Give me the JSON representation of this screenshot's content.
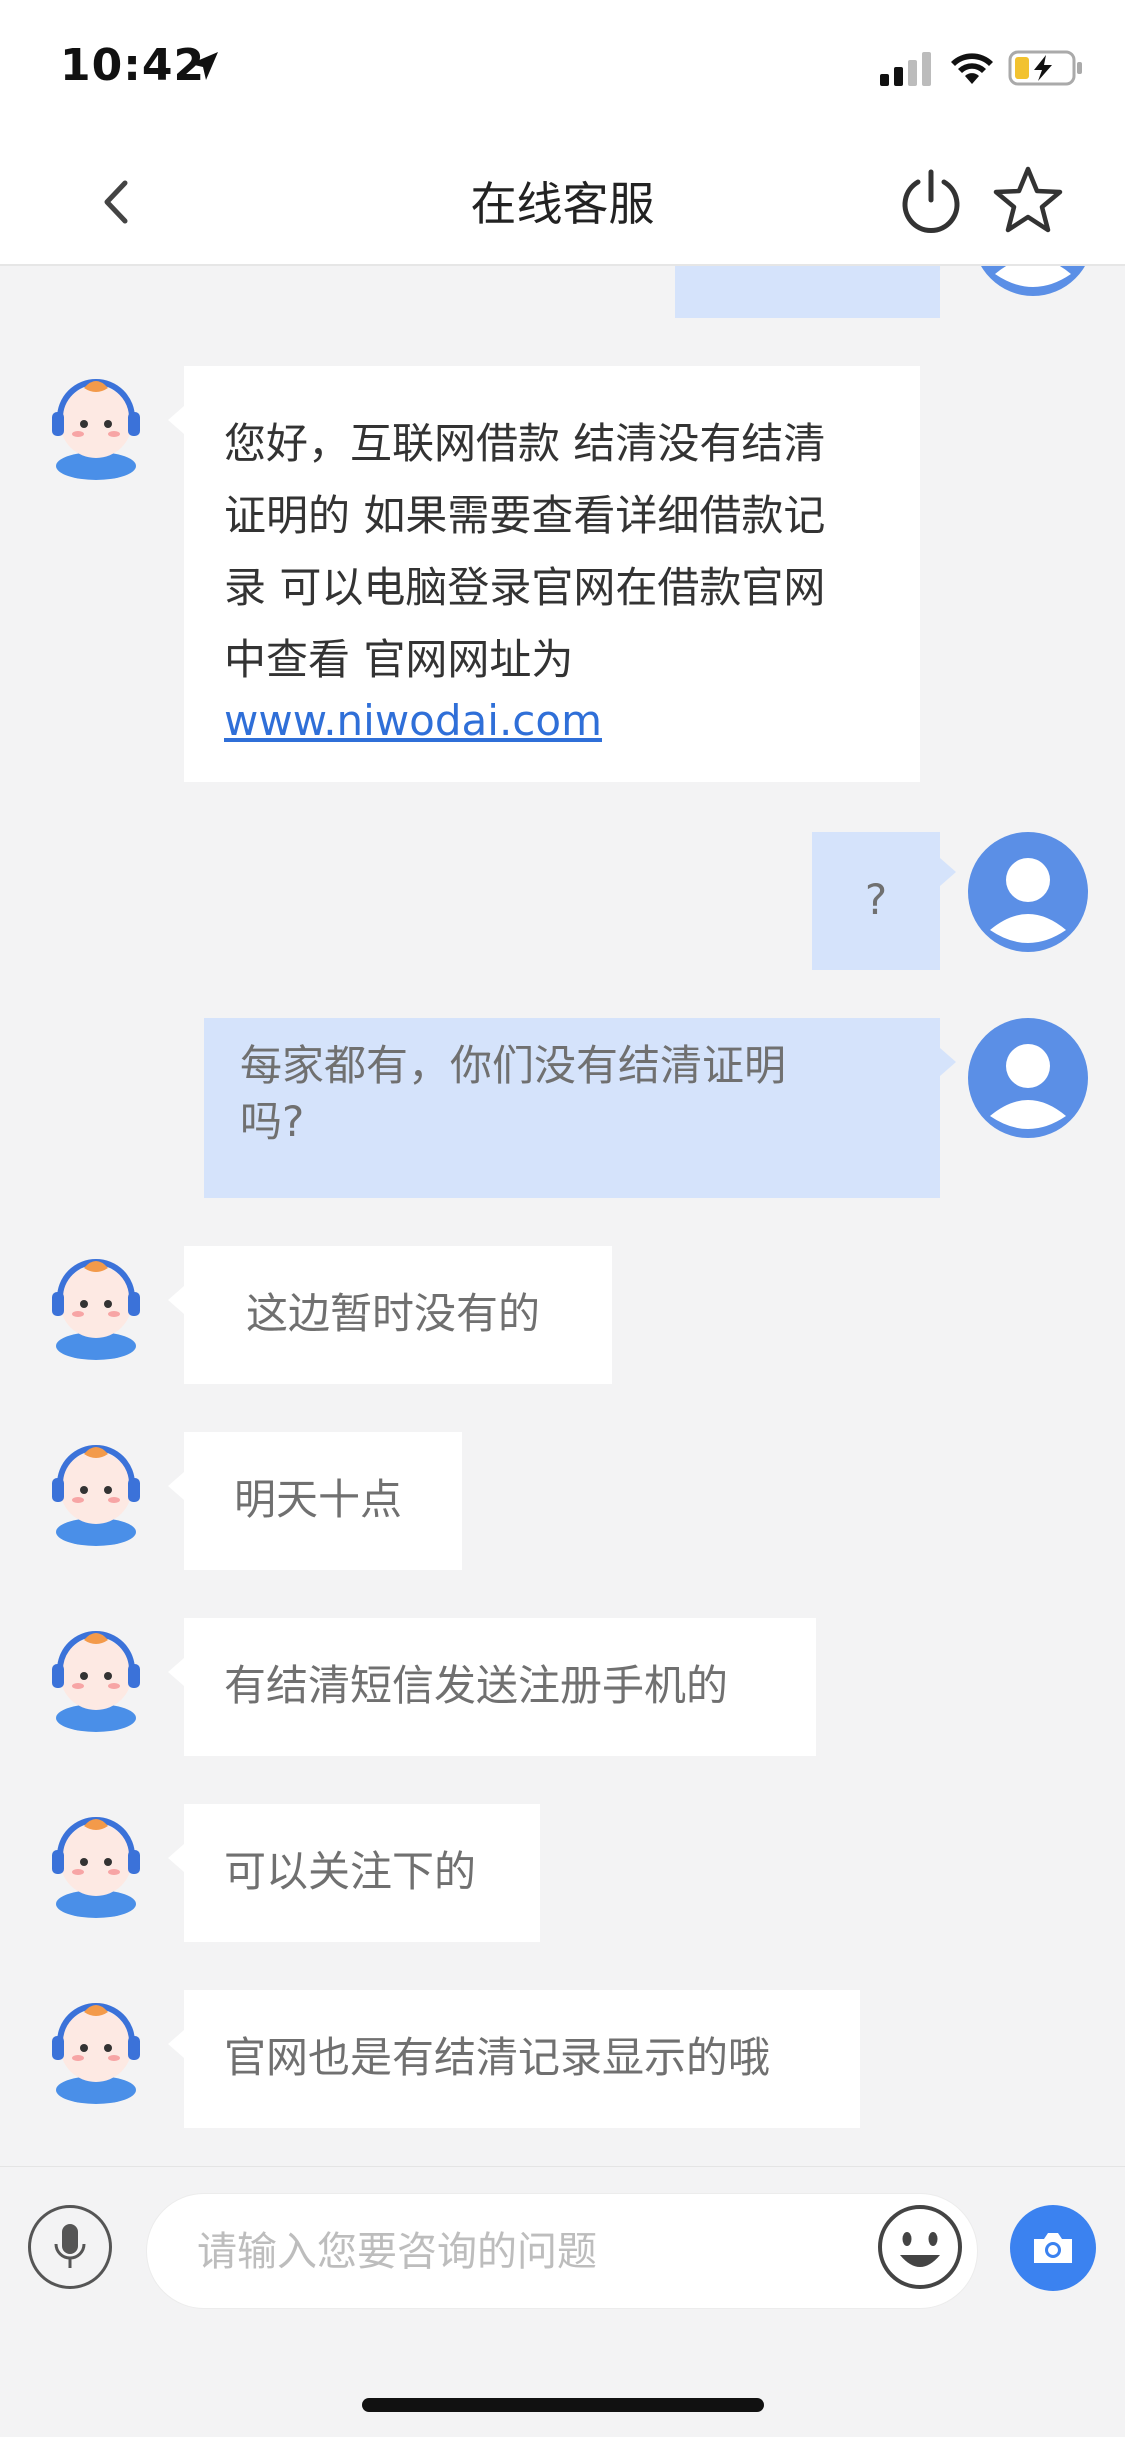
{
  "status_bar": {
    "time": "10:42"
  },
  "nav": {
    "title": "在线客服"
  },
  "messages": [
    {
      "from": "agent",
      "text_lines": [
        "您好，互联网借款 结清没有结清",
        "证明的 如果需要查看详细借款记",
        "录 可以电脑登录官网在借款官网",
        "中查看 官网网址为"
      ],
      "link": "www.niwodai.com"
    },
    {
      "from": "user",
      "text": "?"
    },
    {
      "from": "user",
      "text_lines": [
        "每家都有，你们没有结清证明",
        "吗?"
      ]
    },
    {
      "from": "agent",
      "text": "这边暂时没有的"
    },
    {
      "from": "agent",
      "text": "明天十点"
    },
    {
      "from": "agent",
      "text": "有结清短信发送注册手机的"
    },
    {
      "from": "agent",
      "text": "可以关注下的"
    },
    {
      "from": "agent",
      "text": "官网也是有结清记录显示的哦"
    }
  ],
  "input": {
    "placeholder": "请输入您要咨询的问题"
  },
  "colors": {
    "user_bubble": "#d5e3fb",
    "agent_bubble": "#ffffff",
    "accent": "#3b82f0",
    "link": "#2f6fd8"
  },
  "icons": [
    "location-arrow-icon",
    "signal-icon",
    "wifi-icon",
    "battery-charging-icon",
    "back-chevron-icon",
    "power-icon",
    "star-icon",
    "microphone-icon",
    "emoji-icon",
    "camera-icon",
    "agent-avatar-icon",
    "user-avatar-icon"
  ]
}
